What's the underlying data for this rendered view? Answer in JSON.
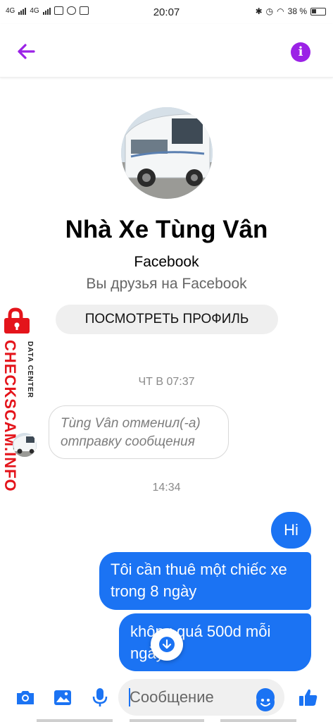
{
  "status_bar": {
    "network_1": "4G",
    "network_2": "4G",
    "time": "20:07",
    "battery": "38 %"
  },
  "header": {
    "back_icon": "arrow-left-icon",
    "info_icon": "info-icon",
    "info_glyph": "i",
    "accent_color": "#9b22e6"
  },
  "profile": {
    "name": "Nhà Xe Tùng Vân",
    "platform": "Facebook",
    "friendship": "Вы друзья на Facebook",
    "view_profile_button": "ПОСМОТРЕТЬ ПРОФИЛЬ"
  },
  "watermark": {
    "brand": "CHECKSCAM.INFO",
    "tag": "DATA CENTER"
  },
  "chat": {
    "timestamp_1": "ЧТ В 07:37",
    "unsent_message": "Tùng Vân отменил(-а) отправку сообщения",
    "timestamp_2": "14:34",
    "messages": [
      {
        "text": "Hi",
        "from": "me"
      },
      {
        "text": "Tôi cần thuê một chiếc xe trong 8 ngày",
        "from": "me"
      },
      {
        "text": "không quá 500d mỗi ngày",
        "from": "me"
      }
    ],
    "bubble_color": "#1b73f3"
  },
  "composer": {
    "placeholder": "Сообщение",
    "icons": [
      "camera-icon",
      "gallery-icon",
      "microphone-icon",
      "emoji-icon",
      "thumbs-up-icon"
    ]
  }
}
